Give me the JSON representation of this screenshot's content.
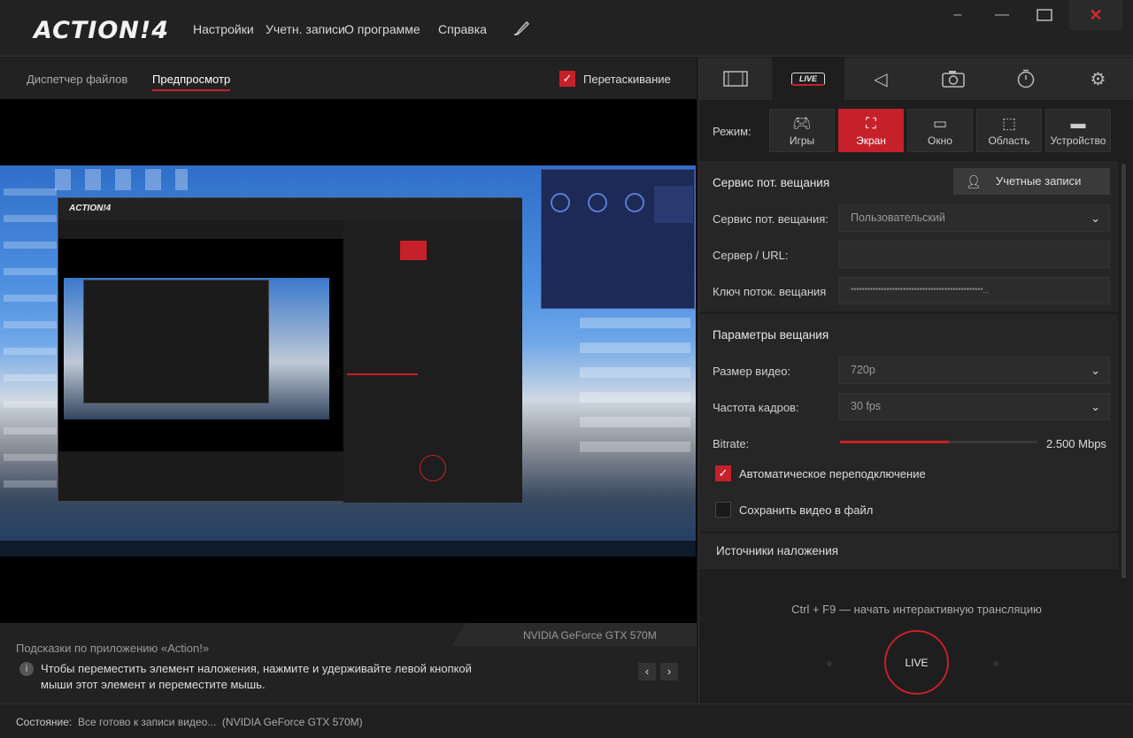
{
  "app": {
    "logo": "ACTION!4"
  },
  "menu": {
    "items": [
      "Настройки",
      "Учетн. записи",
      "О программе",
      "Справка"
    ]
  },
  "left": {
    "tabs": {
      "file_manager": "Диспетчер файлов",
      "preview": "Предпросмотр"
    },
    "drag": {
      "label": "Перетаскивание",
      "checked": true
    },
    "gpu": "NVIDIA GeForce GTX 570M",
    "hints": {
      "title": "Подсказки по приложению «Action!»",
      "line1": "Чтобы переместить элемент наложения, нажмите и удерживайте левой кнопкой",
      "line2": "мыши этот элемент и переместите мышь."
    }
  },
  "status": {
    "label": "Состояние:",
    "text": "Все готово к записи видео...  (NVIDIA GeForce GTX 570M)"
  },
  "right": {
    "tabs": [
      "film-strip-icon",
      "live-icon",
      "speaker-icon",
      "camera-icon",
      "timer-icon",
      "gear-icon"
    ],
    "live_tab_label": "LIVE",
    "mode": {
      "label": "Режим:",
      "options": [
        {
          "label": "Игры",
          "icon": "gamepad-icon"
        },
        {
          "label": "Экран",
          "icon": "expand-icon",
          "active": true
        },
        {
          "label": "Окно",
          "icon": "window-icon"
        },
        {
          "label": "Область",
          "icon": "selection-icon"
        },
        {
          "label": "Устройство",
          "icon": "device-icon"
        }
      ]
    },
    "service": {
      "header": "Сервис пот. вещания",
      "accounts_button": "Учетные записи",
      "service_label": "Сервис пот. вещания:",
      "service_value": "Пользовательский",
      "server_label": "Сервер / URL:",
      "server_value": "",
      "key_label": "Ключ поток. вещания",
      "key_value": "************************************************..."
    },
    "params": {
      "header": "Параметры вещания",
      "size_label": "Размер видео:",
      "size_value": "720p",
      "fps_label": "Частота кадров:",
      "fps_value": "30 fps",
      "bitrate_label": "Bitrate:",
      "bitrate_value": "2.500 Mbps",
      "bitrate_fraction": 0.55,
      "auto_reconnect": "Автоматическое переподключение",
      "auto_reconnect_checked": true,
      "save_file": "Сохранить видео в файл",
      "save_file_checked": false
    },
    "overlays": {
      "header": "Источники наложения"
    },
    "hotkey": "Ctrl + F9 — начать интерактивную трансляцию",
    "live_button": "LIVE"
  },
  "colors": {
    "accent": "#c6202a",
    "bg": "#1e1e1e"
  }
}
